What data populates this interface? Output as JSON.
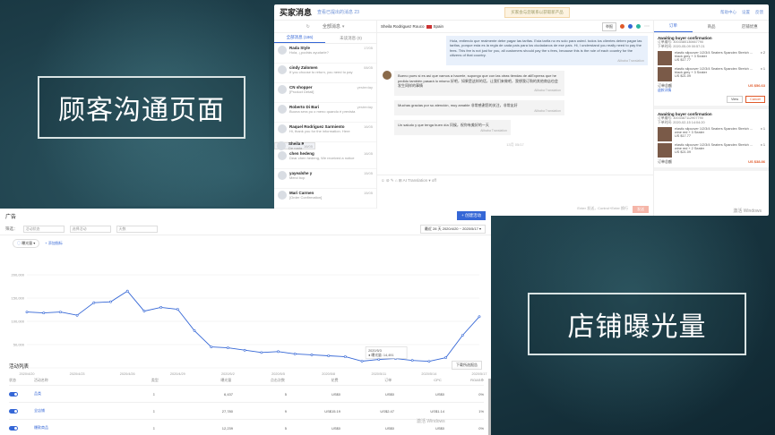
{
  "labels": {
    "customer_comm": "顾客沟通页面",
    "store_exposure": "店铺曝光量"
  },
  "chat": {
    "title": "买家消息",
    "subtitle": "查看已提出的消息 23",
    "notice": "买家会与您联系以获取新产品",
    "top_links": [
      "帮助中心",
      "设置",
      "反馈"
    ],
    "list_header": "全部消息",
    "list_tabs": [
      "全部消息 (186)",
      "未读消息 (0)"
    ],
    "conversations": [
      {
        "name": "Rada Style",
        "msg": "Hola, ¿podrás ayudarle?",
        "time": "17/05"
      },
      {
        "name": "cindy Zalomen",
        "msg": "If you choose to return, you need to pay",
        "time": "08/05"
      },
      {
        "name": "CN shopper",
        "msg": "[Product Detail]",
        "time": "yesterday"
      },
      {
        "name": "Roberto Di Bari",
        "msg": "Buona sera pu o meno quando è prevista",
        "time": "yesterday"
      },
      {
        "name": "Raquel Rodriguez Sarmiento",
        "msg": "Hi, thank you for the information. Here",
        "time": "16/05"
      },
      {
        "name": "Sheila Rodriguez Rouco",
        "msg": "De nada",
        "time": "16/05"
      },
      {
        "name": "chen hedeng",
        "msg": "Dear chen hedeng, We received a notice",
        "time": "16/05"
      },
      {
        "name": "yayealshe y",
        "msg": "Merci bcp",
        "time": "15/05"
      },
      {
        "name": "Mari Carmen",
        "msg": "[Order Confirmation]",
        "time": "15/05"
      }
    ],
    "active_name": "Sheila Rodriguez Rouco",
    "active_country": "Spain",
    "report_btn": "举报",
    "messages": [
      {
        "side": "me",
        "text": "Hola, entiendo que realmente debe pagar las tarifas. Esta tarifa no es solo para usted. todos los clientes deben pagar las tarifas, porque esta es la regla de cada país para los ciudadanos de ese país. Hi, I understand you really need to pay the fees. This fee is not just for you, all customers should pay the s fees, because this is the rule of each country for the citizens of that country.",
        "note": "Alibaba Translation"
      },
      {
        "side": "them",
        "text": "Bueno pues si es así que vamos a hacerle, supongo que con las otras tiendas de aliExpress que he pedido también pasará lo mismo 好吧，如果是这样的话，让我们来做吧，我想我订购的其他商店也会发生同样的事情",
        "note": "Alibaba Translation"
      },
      {
        "side": "them",
        "text": "Muchas gracias por su atención, muy amable 非常感谢您的关注，非常友好",
        "note": "Alibaba Translation"
      },
      {
        "side": "them",
        "text": "Un saludo y que tenga buen día 问候，祝你有美好的一天",
        "note": "Alibaba Translation"
      }
    ],
    "date_divider": "13月 05/17",
    "composer_tools": "☺ ⊘ ✎ ⌂ ⊞ AI Translation ▾ off",
    "composer_hint": "Enter 发送，Control+Enter 换行",
    "send_label": "发送",
    "order_tabs": [
      "订单",
      "商品",
      "店铺优惠"
    ],
    "orders": [
      {
        "status": "Awaiting buyer confirmation",
        "number": "订单编号: 3003480130667790",
        "date": "下单时间: 2020-05-09 00:57:21",
        "items": [
          {
            "desc": "elastic slipcover 1/2/3/4 Seaters Spandex Stretch ... black grey + 3 Seater",
            "qty": "x 2",
            "price": "US $17.77"
          },
          {
            "desc": "elastic slipcover 1/2/3/4 Seaters Spandex Stretch ... black grey + 3 Seater",
            "qty": "x 1",
            "price": "US $21.09"
          }
        ],
        "total_label": "订单总额",
        "total": "US $56.63",
        "link": "退款详情",
        "btn_view": "View",
        "btn_cancel": "Cancel"
      },
      {
        "status": "Awaiting buyer confirmation",
        "number": "订单编号: 3003487112907790",
        "date": "下单时间: 2020-02-15 14:04:20",
        "items": [
          {
            "desc": "elastic slipcover 1/2/3/4 Seaters Spandex Stretch ... wine red + 3 Seater",
            "qty": "x 1",
            "price": "US $17.77"
          },
          {
            "desc": "elastic slipcover 1/2/3/4 Seaters Spandex Stretch ... wine red + 2 Seater",
            "qty": "x 1",
            "price": "US $21.09"
          }
        ],
        "total_label": "订单总额",
        "total": "US $38.86"
      }
    ],
    "watermark": "激活 Windows"
  },
  "ads": {
    "title": "广告",
    "new_btn": "+ 创建活动",
    "filter_label": "筛选：",
    "filters": [
      "活动状态",
      "选择活动",
      "天数"
    ],
    "date_label": "最近 28 天",
    "date_range": "2020/4/20 ~ 2020/5/17",
    "metric": "曝光量",
    "add_metric": "+ 添加指标",
    "tooltip_date": "2020/5/3",
    "tooltip_value": "● 曝光量: 14,491",
    "list_title": "活动列表",
    "export_btn": "下载所选报告",
    "columns": [
      "状态",
      "活动名称",
      "类型",
      "曝光量",
      "点击次数",
      "花费",
      "订单",
      "CPC",
      "ROAS"
    ],
    "rows": [
      {
        "name": "品类",
        "type": "⇩",
        "impressions": "6,437",
        "clicks": "5",
        "spend": "US$0",
        "orders": "US$0",
        "cpc": "US$0",
        "roas": "0%"
      },
      {
        "name": "全店铺",
        "type": "⇩",
        "impressions": "27,780",
        "clicks": "9",
        "spend": "US$15.19",
        "orders": "US$2.47",
        "cpc": "US$1.14",
        "roas": "1%"
      },
      {
        "name": "爆款商品",
        "type": "⇩",
        "impressions": "12,239",
        "clicks": "5",
        "spend": "US$0",
        "orders": "US$0",
        "cpc": "US$0",
        "roas": "0%"
      }
    ],
    "watermark": "激活 Windows"
  },
  "chart_data": {
    "type": "line",
    "title": "",
    "series": [
      {
        "name": "曝光量",
        "values": [
          120000,
          118000,
          120000,
          113000,
          140000,
          142000,
          165000,
          122000,
          130000,
          126000,
          80000,
          45000,
          43000,
          38000,
          33000,
          35000,
          30000,
          28000,
          26000,
          24000,
          14491,
          18000,
          20000,
          16000,
          14000,
          22000,
          70000,
          110000
        ]
      }
    ],
    "x": [
      "2020/4/20",
      "2020/4/21",
      "2020/4/22",
      "2020/4/23",
      "2020/4/24",
      "2020/4/25",
      "2020/4/26",
      "2020/4/27",
      "2020/4/28",
      "2020/4/29",
      "2020/4/30",
      "2020/5/1",
      "2020/5/2",
      "2020/5/3",
      "2020/5/4",
      "2020/5/5",
      "2020/5/6",
      "2020/5/7",
      "2020/5/8",
      "2020/5/9",
      "2020/5/10",
      "2020/5/11",
      "2020/5/12",
      "2020/5/13",
      "2020/5/14",
      "2020/5/15",
      "2020/5/16",
      "2020/5/17"
    ],
    "x_ticks": [
      "2020/4/20",
      "2020/4/23",
      "2020/4/26",
      "2020/4/29",
      "2020/5/2",
      "2020/5/5",
      "2020/5/8",
      "2020/5/11",
      "2020/5/14",
      "2020/5/17"
    ],
    "y_ticks": [
      "200,000",
      "150,000",
      "100,000",
      "50,000",
      "0"
    ],
    "ylim": [
      0,
      200000
    ],
    "line_color": "#3567d6",
    "grid": true
  }
}
